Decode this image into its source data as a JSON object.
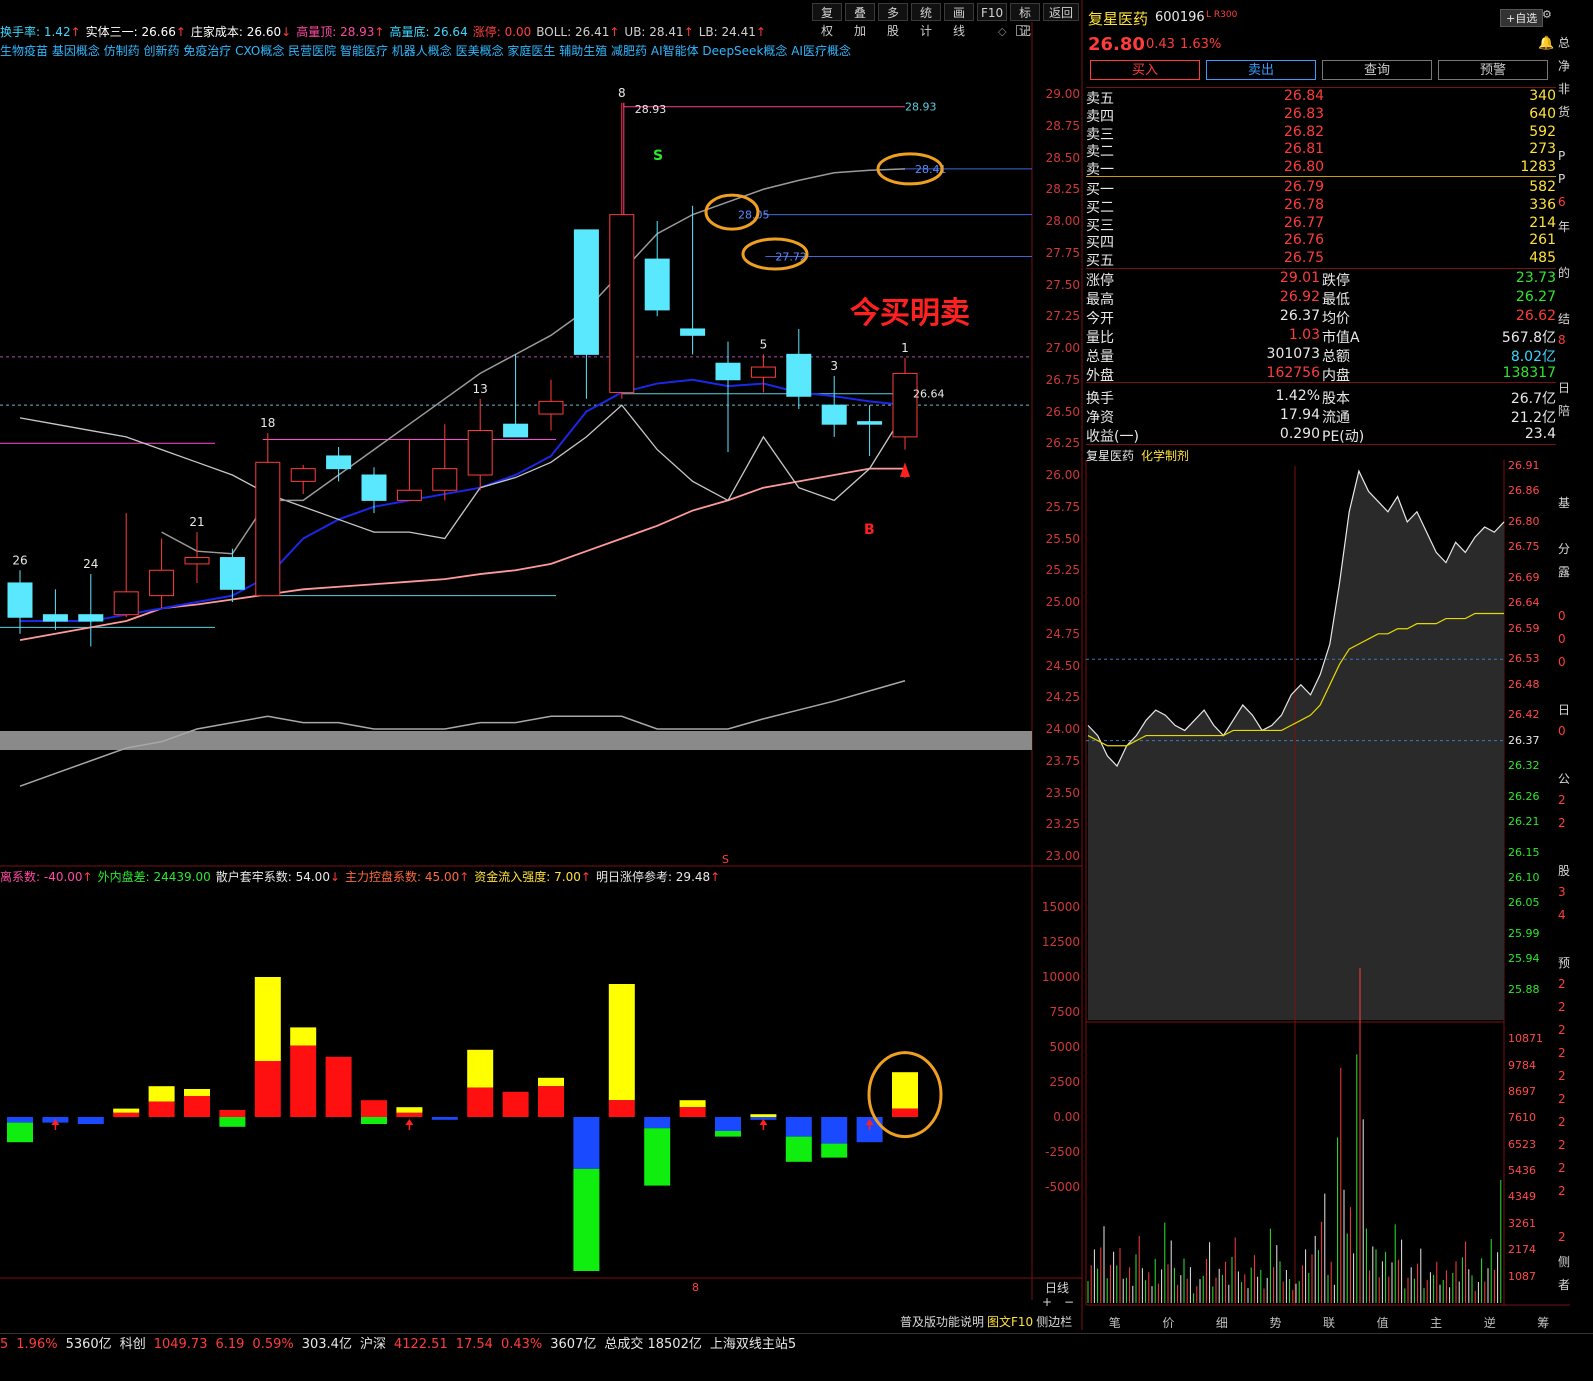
{
  "toolbar": [
    "复权",
    "叠加",
    "多股",
    "统计",
    "画线",
    "F10",
    "标记",
    "返回"
  ],
  "info_line": [
    {
      "label": "换手率: ",
      "value": "1.42",
      "arrow": "↑",
      "color": "#3ad8ff"
    },
    {
      "label": "实体三一: ",
      "value": "26.66",
      "arrow": "↑",
      "color": "#ffffff"
    },
    {
      "label": "庄家成本: ",
      "value": "26.60",
      "arrow": "↓",
      "color": "#ffffff"
    },
    {
      "label": "高量顶: ",
      "value": "28.93",
      "arrow": "↑",
      "color": "#ff4aa0"
    },
    {
      "label": "高量底: ",
      "value": "26.64",
      "arrow": "",
      "color": "#3ad8ff"
    },
    {
      "label": "涨停: ",
      "value": "0.00",
      "arrow": "",
      "color": "#ff4040"
    },
    {
      "label": "BOLL: ",
      "value": "26.41",
      "arrow": "↑",
      "color": "#d0d0d0"
    },
    {
      "label": "UB: ",
      "value": "28.41",
      "arrow": "↑",
      "color": "#d0d0d0"
    },
    {
      "label": "LB: ",
      "value": "24.41",
      "arrow": "↑",
      "color": "#d0d0d0"
    }
  ],
  "concepts": "生物疫苗 基因概念 仿制药 创新药 免疫治疗 CXO概念 民营医院 智能医疗 机器人概念 医美概念 家庭医生 辅助生殖 减肥药 AI智能体 DeepSeek概念 AI医疗概念",
  "indicator_line": [
    {
      "label": "离系数: ",
      "value": "-40.00",
      "arrow": "↑",
      "color": "#ff4aa0"
    },
    {
      "label": "外内盘差: ",
      "value": "24439.00",
      "arrow": "",
      "color": "#2ee62e"
    },
    {
      "label": "散户套牢系数: ",
      "value": "54.00",
      "arrow": "↓",
      "color": "#e8e8e8"
    },
    {
      "label": "主力控盘系数: ",
      "value": "45.00",
      "arrow": "↑",
      "color": "#ff6a3a"
    },
    {
      "label": "资金流入强度: ",
      "value": "7.00",
      "arrow": "↑",
      "color": "#ffe23a"
    },
    {
      "label": "明日涨停参考: ",
      "value": "29.48",
      "arrow": "↑",
      "color": "#e8e8e8"
    }
  ],
  "chart_annotations": {
    "headline": "今买明卖",
    "s_label": "S",
    "b_label": "B",
    "top_label": "28.93",
    "top_label_right": "28.93",
    "ub_label": "28.41",
    "l2_label": "28.05",
    "l3_label": "27.72",
    "hv_label": "26.64",
    "bottom_marker": "S",
    "vol_axis_marker": "8",
    "period": "日线",
    "plus": "+",
    "minus": "−"
  },
  "chart_data": [
    {
      "type": "candlestick",
      "title": "",
      "price_axis": [
        "29.00",
        "28.75",
        "28.50",
        "28.25",
        "28.00",
        "27.75",
        "27.50",
        "27.25",
        "27.00",
        "26.75",
        "26.50",
        "26.25",
        "26.00",
        "25.75",
        "25.50",
        "25.25",
        "25.00",
        "24.75",
        "24.50",
        "24.25",
        "24.00",
        "23.75",
        "23.50",
        "23.25",
        "23.00"
      ],
      "ylim": [
        22.95,
        29.5
      ],
      "candles": [
        {
          "o": 25.15,
          "h": 25.25,
          "l": 24.75,
          "c": 24.88,
          "n": "26"
        },
        {
          "o": 24.9,
          "h": 25.1,
          "l": 24.78,
          "c": 24.85,
          "n": ""
        },
        {
          "o": 24.9,
          "h": 25.22,
          "l": 24.65,
          "c": 24.85,
          "n": "24"
        },
        {
          "o": 24.9,
          "h": 25.7,
          "l": 24.88,
          "c": 25.08,
          "n": ""
        },
        {
          "o": 25.05,
          "h": 25.5,
          "l": 24.95,
          "c": 25.25,
          "n": ""
        },
        {
          "o": 25.3,
          "h": 25.55,
          "l": 25.15,
          "c": 25.35,
          "n": "21"
        },
        {
          "o": 25.35,
          "h": 25.42,
          "l": 25.0,
          "c": 25.1,
          "n": ""
        },
        {
          "o": 25.05,
          "h": 26.33,
          "l": 25.05,
          "c": 26.1,
          "n": "18"
        },
        {
          "o": 25.95,
          "h": 26.08,
          "l": 25.85,
          "c": 26.05,
          "n": ""
        },
        {
          "o": 26.15,
          "h": 26.22,
          "l": 25.95,
          "c": 26.05,
          "n": ""
        },
        {
          "o": 26.0,
          "h": 26.06,
          "l": 25.7,
          "c": 25.8,
          "n": ""
        },
        {
          "o": 25.8,
          "h": 26.28,
          "l": 25.82,
          "c": 25.88,
          "n": ""
        },
        {
          "o": 25.88,
          "h": 26.4,
          "l": 25.8,
          "c": 26.05,
          "n": ""
        },
        {
          "o": 26.0,
          "h": 26.6,
          "l": 25.88,
          "c": 26.35,
          "n": "13"
        },
        {
          "o": 26.4,
          "h": 26.95,
          "l": 26.35,
          "c": 26.3,
          "n": ""
        },
        {
          "o": 26.48,
          "h": 26.75,
          "l": 26.35,
          "c": 26.58,
          "n": ""
        },
        {
          "o": 27.93,
          "h": 27.85,
          "l": 26.6,
          "c": 26.95,
          "n": ""
        },
        {
          "o": 26.65,
          "h": 28.93,
          "l": 26.6,
          "c": 28.05,
          "n": "8"
        },
        {
          "o": 27.7,
          "h": 28.0,
          "l": 27.25,
          "c": 27.3,
          "n": ""
        },
        {
          "o": 27.15,
          "h": 28.12,
          "l": 26.95,
          "c": 27.1,
          "n": ""
        },
        {
          "o": 26.88,
          "h": 27.05,
          "l": 26.18,
          "c": 26.75,
          "n": ""
        },
        {
          "o": 26.77,
          "h": 26.95,
          "l": 26.65,
          "c": 26.85,
          "n": "5"
        },
        {
          "o": 26.95,
          "h": 27.15,
          "l": 26.52,
          "c": 26.62,
          "n": ""
        },
        {
          "o": 26.55,
          "h": 26.78,
          "l": 26.3,
          "c": 26.4,
          "n": "3"
        },
        {
          "o": 26.42,
          "h": 26.55,
          "l": 26.15,
          "c": 26.4,
          "n": ""
        },
        {
          "o": 26.3,
          "h": 26.92,
          "l": 26.2,
          "c": 26.8,
          "n": "1"
        }
      ],
      "ma_gray": [
        26.45,
        26.4,
        26.35,
        26.3,
        26.2,
        26.1,
        26.0,
        25.85,
        25.75,
        25.65,
        25.55,
        25.55,
        25.5,
        25.9,
        25.98,
        26.1,
        26.3,
        26.55,
        26.2,
        25.95,
        25.8,
        26.3,
        25.9,
        25.8,
        26.05,
        26.5
      ],
      "ma_blue": [
        24.85,
        24.85,
        24.85,
        24.9,
        24.95,
        25.0,
        25.05,
        25.2,
        25.5,
        25.65,
        25.75,
        25.8,
        25.85,
        25.9,
        26.0,
        26.15,
        26.5,
        26.65,
        26.72,
        26.75,
        26.7,
        26.72,
        26.65,
        26.62,
        26.58,
        26.55
      ],
      "ma_pink": [
        24.7,
        24.75,
        24.8,
        24.85,
        24.95,
        24.98,
        25.02,
        25.06,
        25.1,
        25.12,
        25.14,
        25.16,
        25.18,
        25.22,
        25.25,
        25.3,
        25.4,
        25.5,
        25.6,
        25.72,
        25.8,
        25.9,
        25.95,
        26.0,
        26.05,
        26.05
      ],
      "lb_line": [
        23.55,
        23.65,
        23.75,
        23.85,
        23.9,
        24.0,
        24.05,
        24.1,
        24.05,
        24.05,
        24.0,
        24.0,
        24.0,
        24.05,
        24.05,
        24.1,
        24.1,
        24.1,
        24.0,
        24.0,
        24.0,
        24.08,
        24.15,
        24.22,
        24.3,
        24.38
      ]
    },
    {
      "type": "bar",
      "title": "",
      "axis": [
        "15000",
        "12500",
        "10000",
        "7500",
        "5000",
        "2500",
        "0.00",
        "-2500",
        "-5000"
      ],
      "ylim": [
        -11000,
        16500
      ],
      "bars": [
        {
          "pos": [
            0,
            0
          ],
          "neg": [
            -400,
            -1800
          ],
          "up": false
        },
        {
          "pos": [
            0,
            0
          ],
          "neg": [
            -400,
            0
          ],
          "up": true
        },
        {
          "pos": [
            0,
            0
          ],
          "neg": [
            -500,
            0
          ],
          "up": false
        },
        {
          "pos": [
            300,
            600
          ],
          "neg": [
            0,
            0
          ],
          "up": false
        },
        {
          "pos": [
            1100,
            2200
          ],
          "neg": [
            0,
            0
          ],
          "up": false
        },
        {
          "pos": [
            1500,
            2000
          ],
          "neg": [
            0,
            0
          ],
          "up": false
        },
        {
          "pos": [
            500,
            0
          ],
          "neg": [
            0,
            -700
          ],
          "up": false
        },
        {
          "pos": [
            4000,
            10000
          ],
          "neg": [
            0,
            0
          ],
          "up": false
        },
        {
          "pos": [
            5100,
            6400
          ],
          "neg": [
            0,
            0
          ],
          "up": false
        },
        {
          "pos": [
            4300,
            0
          ],
          "neg": [
            0,
            0
          ],
          "up": false
        },
        {
          "pos": [
            1200,
            0
          ],
          "neg": [
            0,
            -500
          ],
          "up": false
        },
        {
          "pos": [
            300,
            700
          ],
          "neg": [
            0,
            0
          ],
          "up": true
        },
        {
          "pos": [
            0,
            0
          ],
          "neg": [
            -200,
            0
          ],
          "up": false
        },
        {
          "pos": [
            2100,
            4800
          ],
          "neg": [
            0,
            0
          ],
          "up": false
        },
        {
          "pos": [
            1800,
            0
          ],
          "neg": [
            0,
            0
          ],
          "up": false
        },
        {
          "pos": [
            2200,
            2800
          ],
          "neg": [
            0,
            0
          ],
          "up": false
        },
        {
          "pos": [
            0,
            0
          ],
          "neg": [
            -3700,
            -11000
          ],
          "up": false
        },
        {
          "pos": [
            1200,
            9500
          ],
          "neg": [
            0,
            0
          ],
          "up": false
        },
        {
          "pos": [
            0,
            0
          ],
          "neg": [
            -800,
            -4900
          ],
          "up": false
        },
        {
          "pos": [
            700,
            1200
          ],
          "neg": [
            0,
            0
          ],
          "up": false
        },
        {
          "pos": [
            0,
            0
          ],
          "neg": [
            -1000,
            -1400
          ],
          "up": false
        },
        {
          "pos": [
            0,
            200
          ],
          "neg": [
            -200,
            0
          ],
          "up": true
        },
        {
          "pos": [
            0,
            0
          ],
          "neg": [
            -1400,
            -3200
          ],
          "up": false
        },
        {
          "pos": [
            0,
            0
          ],
          "neg": [
            -1900,
            -2900
          ],
          "up": false
        },
        {
          "pos": [
            0,
            0
          ],
          "neg": [
            -1800,
            0
          ],
          "up": true
        },
        {
          "pos": [
            600,
            3200
          ],
          "neg": [
            0,
            0
          ],
          "up": false
        }
      ]
    },
    {
      "type": "line",
      "title": "",
      "price_axis": [
        "26.91",
        "26.86",
        "26.80",
        "26.75",
        "26.69",
        "26.64",
        "26.59",
        "26.53",
        "26.48",
        "26.42",
        "26.37",
        "26.32",
        "26.26",
        "26.21",
        "26.15",
        "26.10",
        "26.05",
        "25.99",
        "25.94",
        "25.88"
      ],
      "ylim": [
        25.84,
        26.94
      ],
      "prev_close": 26.37,
      "price": [
        26.4,
        26.38,
        26.34,
        26.32,
        26.36,
        26.38,
        26.41,
        26.43,
        26.42,
        26.4,
        26.39,
        26.41,
        26.43,
        26.4,
        26.38,
        26.41,
        26.44,
        26.42,
        26.39,
        26.4,
        26.42,
        26.46,
        26.48,
        26.46,
        26.5,
        26.56,
        26.68,
        26.82,
        26.9,
        26.86,
        26.84,
        26.82,
        26.85,
        26.8,
        26.82,
        26.78,
        26.74,
        26.72,
        26.76,
        26.74,
        26.77,
        26.79,
        26.78,
        26.8
      ],
      "avg": [
        26.38,
        26.37,
        26.36,
        26.36,
        26.36,
        26.37,
        26.38,
        26.38,
        26.38,
        26.38,
        26.38,
        26.38,
        26.38,
        26.38,
        26.38,
        26.39,
        26.39,
        26.39,
        26.39,
        26.39,
        26.39,
        26.4,
        26.41,
        26.42,
        26.44,
        26.48,
        26.52,
        26.55,
        26.56,
        26.57,
        26.58,
        26.58,
        26.59,
        26.59,
        26.6,
        26.6,
        26.6,
        26.61,
        26.61,
        26.61,
        26.62,
        26.62,
        26.62,
        26.62
      ]
    },
    {
      "type": "bar",
      "title": "",
      "axis": [
        "10871",
        "9784",
        "8697",
        "7610",
        "6523",
        "5436",
        "4349",
        "3261",
        "2174",
        "1087"
      ],
      "ylim": [
        0,
        11500
      ],
      "volumes": [
        1800,
        2400,
        1500,
        2000,
        1200,
        2100,
        900,
        1600,
        2700,
        1100,
        1300,
        800,
        1900,
        1000,
        1500,
        2200,
        900,
        1400,
        1200,
        2500,
        1300,
        700,
        1800,
        2100,
        3200,
        1500,
        7900,
        3000,
        9800,
        2700,
        1800,
        1600,
        2300,
        1200,
        1700,
        900,
        1500,
        1100,
        1300,
        1800,
        1000,
        1500,
        2000,
        3600
      ]
    }
  ],
  "right_panel": {
    "stock_name": "复星医药",
    "stock_code": "600196",
    "tag": "L R300",
    "price": "26.80",
    "change": "0.43",
    "change_pct": "1.63%",
    "self_select": "+自选",
    "buttons": [
      "买入",
      "卖出",
      "查询",
      "预警"
    ],
    "orderbook": [
      {
        "label": "卖五",
        "price": "26.84",
        "vol": "340"
      },
      {
        "label": "卖四",
        "price": "26.83",
        "vol": "640"
      },
      {
        "label": "卖三",
        "price": "26.82",
        "vol": "592"
      },
      {
        "label": "卖二",
        "price": "26.81",
        "vol": "273"
      },
      {
        "label": "卖一",
        "price": "26.80",
        "vol": "1283"
      },
      {
        "label": "买一",
        "price": "26.79",
        "vol": "582"
      },
      {
        "label": "买二",
        "price": "26.78",
        "vol": "336"
      },
      {
        "label": "买三",
        "price": "26.77",
        "vol": "214"
      },
      {
        "label": "买四",
        "price": "26.76",
        "vol": "261"
      },
      {
        "label": "买五",
        "price": "26.75",
        "vol": "485"
      }
    ],
    "stats": [
      {
        "l1": "涨停",
        "v1": "29.01",
        "c1": "red",
        "l2": "跌停",
        "v2": "23.73",
        "c2": "green"
      },
      {
        "l1": "最高",
        "v1": "26.92",
        "c1": "red",
        "l2": "最低",
        "v2": "26.27",
        "c2": "green"
      },
      {
        "l1": "今开",
        "v1": "26.37",
        "c1": "white",
        "l2": "均价",
        "v2": "26.62",
        "c2": "red"
      },
      {
        "l1": "量比",
        "v1": "1.03",
        "c1": "red",
        "l2": "市值A",
        "v2": "567.8亿",
        "c2": "white"
      },
      {
        "l1": "总量",
        "v1": "301073",
        "c1": "white",
        "l2": "总额",
        "v2": "8.02亿",
        "c2": "cyan"
      },
      {
        "l1": "外盘",
        "v1": "162756",
        "c1": "red",
        "l2": "内盘",
        "v2": "138317",
        "c2": "green"
      },
      {
        "l1": "换手",
        "v1": "1.42%",
        "c1": "white",
        "l2": "股本",
        "v2": "26.7亿",
        "c2": "white"
      },
      {
        "l1": "净资",
        "v1": "17.94",
        "c1": "white",
        "l2": "流通",
        "v2": "21.2亿",
        "c2": "white"
      },
      {
        "l1": "收益(一)",
        "v1": "0.290",
        "c1": "white",
        "l2": "PE(动)",
        "v2": "23.4",
        "c2": "white"
      }
    ],
    "sector_name": "复星医药",
    "sector_tag": "化学制剂",
    "tabs": [
      "笔",
      "价",
      "细",
      "势",
      "联",
      "值",
      "主",
      "逆",
      "筹"
    ],
    "edge_chars": [
      "总",
      "净",
      "非",
      "货",
      "",
      "P",
      "P",
      "6",
      "年",
      "",
      "的",
      "",
      "结",
      "8",
      "",
      "日",
      "陪",
      "",
      "",
      "",
      "基",
      "",
      "分",
      "露",
      "",
      "0",
      "0",
      "0",
      "",
      "日",
      "0",
      "",
      "公",
      "2",
      "2",
      "",
      "股",
      "3",
      "4",
      "",
      "预",
      "2",
      "2",
      "2",
      "2",
      "2",
      "2",
      "2",
      "2",
      "2",
      "2",
      "",
      "2",
      "侧",
      "者"
    ]
  },
  "bottom_links": [
    {
      "text": "普及版功能说明",
      "color": "#d8d8d8"
    },
    {
      "text": "图文F10",
      "color": "#ffe23a"
    },
    {
      "text": "侧边栏",
      "color": "#d8d8d8"
    }
  ],
  "status_bar": [
    {
      "text": "5",
      "color": "#ff3c3c"
    },
    {
      "text": "1.96%",
      "color": "#ff3c3c"
    },
    {
      "text": "5360亿",
      "color": "#e8e8e8"
    },
    {
      "text": "科创",
      "color": "#e8e8e8"
    },
    {
      "text": "1049.73",
      "color": "#ff3c3c"
    },
    {
      "text": "6.19",
      "color": "#ff3c3c"
    },
    {
      "text": "0.59%",
      "color": "#ff3c3c"
    },
    {
      "text": "303.4亿",
      "color": "#e8e8e8"
    },
    {
      "text": "沪深",
      "color": "#e8e8e8"
    },
    {
      "text": "4122.51",
      "color": "#ff3c3c"
    },
    {
      "text": "17.54",
      "color": "#ff3c3c"
    },
    {
      "text": "0.43%",
      "color": "#ff3c3c"
    },
    {
      "text": "3607亿",
      "color": "#e8e8e8"
    },
    {
      "text": "总成交 18502亿",
      "color": "#e8e8e8"
    },
    {
      "text": "上海双线主站5",
      "color": "#e8e8e8"
    }
  ]
}
